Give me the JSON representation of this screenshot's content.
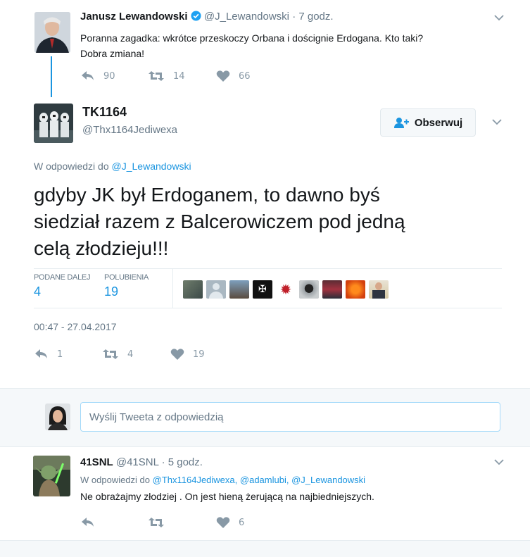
{
  "tweet1": {
    "name": "Janusz Lewandowski",
    "handle": "@J_Lewandowski",
    "time": "· 7 godz.",
    "text_line1": "Poranna zagadka: wkrótce przeskoczy Orbana i doścignie Erdogana. Kto taki?",
    "text_line2": "Dobra zmiana!",
    "replies": "90",
    "retweets": "14",
    "likes": "66"
  },
  "tweet2": {
    "name": "TK1164",
    "handle": "@Thx1164Jediwexa",
    "follow_label": "Obserwuj",
    "reply_prefix": "W odpowiedzi do",
    "reply_to": "@J_Lewandowski",
    "text_line1": "gdyby JK był Erdoganem, to dawno byś",
    "text_line2": "siedział razem z Balcerowiczem pod jedną",
    "text_line3": "celą złodzieju!!!",
    "stats": {
      "retweets_label": "PODANE DALEJ",
      "retweets_value": "4",
      "likes_label": "POLUBIENIA",
      "likes_value": "19"
    },
    "timestamp": "00:47 - 27.04.2017",
    "actions": {
      "replies": "1",
      "retweets": "4",
      "likes": "19"
    }
  },
  "reply_box": {
    "placeholder": "Wyślij Tweeta z odpowiedzią"
  },
  "tweet3": {
    "name": "41SNL",
    "handle": "@41SNL",
    "time": "· 5 godz.",
    "reply_prefix": "W odpowiedzi do",
    "reply_to_1": "@Thx1164Jediwexa,",
    "reply_to_2": "@adamlubi,",
    "reply_to_3": "@J_Lewandowski",
    "text": "Ne obrażajmy złodziej . On jest hieną żerującą na najbiedniejszych.",
    "likes": "6"
  },
  "colors": {
    "accent": "#1b95e0",
    "muted": "#657786",
    "icon": "#8899a6",
    "divider": "#e6ecf0",
    "reply_band": "#f5f8fa"
  }
}
